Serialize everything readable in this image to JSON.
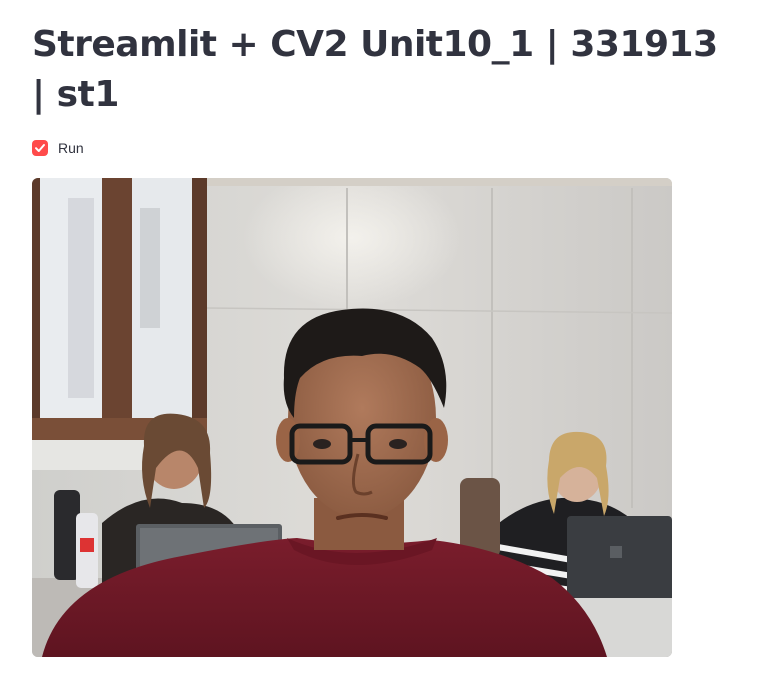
{
  "page": {
    "title": "Streamlit + CV2 Unit10_1 | 331913 | st1"
  },
  "run_checkbox": {
    "label": "Run",
    "checked": true,
    "accent_color": "#FF4B4B"
  },
  "video": {
    "icon": "webcam-frame",
    "description_name": "webcam-video-frame"
  }
}
